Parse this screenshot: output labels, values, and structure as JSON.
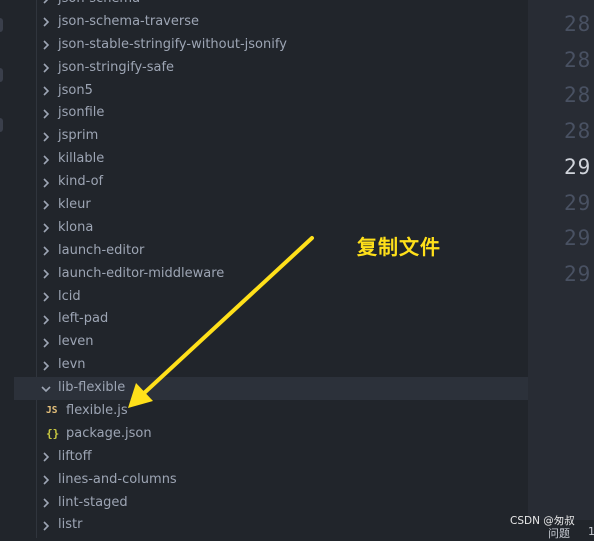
{
  "explorer": {
    "items": [
      {
        "label": "json-schema",
        "type": "folder",
        "expanded": false
      },
      {
        "label": "json-schema-traverse",
        "type": "folder",
        "expanded": false
      },
      {
        "label": "json-stable-stringify-without-jsonify",
        "type": "folder",
        "expanded": false
      },
      {
        "label": "json-stringify-safe",
        "type": "folder",
        "expanded": false
      },
      {
        "label": "json5",
        "type": "folder",
        "expanded": false
      },
      {
        "label": "jsonfile",
        "type": "folder",
        "expanded": false
      },
      {
        "label": "jsprim",
        "type": "folder",
        "expanded": false
      },
      {
        "label": "killable",
        "type": "folder",
        "expanded": false
      },
      {
        "label": "kind-of",
        "type": "folder",
        "expanded": false
      },
      {
        "label": "kleur",
        "type": "folder",
        "expanded": false
      },
      {
        "label": "klona",
        "type": "folder",
        "expanded": false
      },
      {
        "label": "launch-editor",
        "type": "folder",
        "expanded": false
      },
      {
        "label": "launch-editor-middleware",
        "type": "folder",
        "expanded": false
      },
      {
        "label": "lcid",
        "type": "folder",
        "expanded": false
      },
      {
        "label": "left-pad",
        "type": "folder",
        "expanded": false
      },
      {
        "label": "leven",
        "type": "folder",
        "expanded": false
      },
      {
        "label": "levn",
        "type": "folder",
        "expanded": false
      },
      {
        "label": "lib-flexible",
        "type": "folder",
        "expanded": true
      },
      {
        "label": "flexible.js",
        "type": "file",
        "icon": "js-file-icon",
        "icon_text": "JS"
      },
      {
        "label": "package.json",
        "type": "file",
        "icon": "json-file-icon",
        "icon_text": "{}"
      },
      {
        "label": "liftoff",
        "type": "folder",
        "expanded": false
      },
      {
        "label": "lines-and-columns",
        "type": "folder",
        "expanded": false
      },
      {
        "label": "lint-staged",
        "type": "folder",
        "expanded": false
      },
      {
        "label": "listr",
        "type": "folder",
        "expanded": false
      }
    ]
  },
  "editor": {
    "line_numbers": [
      {
        "text": "28",
        "current": false
      },
      {
        "text": "28",
        "current": false
      },
      {
        "text": "28",
        "current": false
      },
      {
        "text": "28",
        "current": false
      },
      {
        "text": "29",
        "current": true
      },
      {
        "text": "29",
        "current": false
      },
      {
        "text": "29",
        "current": false
      },
      {
        "text": "29",
        "current": false
      }
    ]
  },
  "annotation": {
    "text": "复制文件",
    "color": "#ffe01a"
  },
  "statusbar": {
    "problems_label": "问题",
    "count": "1"
  },
  "watermark": {
    "text": "CSDN @匆叔"
  },
  "colors": {
    "sidebar_bg": "#21252b",
    "editor_bg": "#282c34",
    "text": "#9da5b4",
    "active_row": "#2c313a",
    "js_icon": "#e5c07b",
    "json_icon": "#cbcb41"
  }
}
